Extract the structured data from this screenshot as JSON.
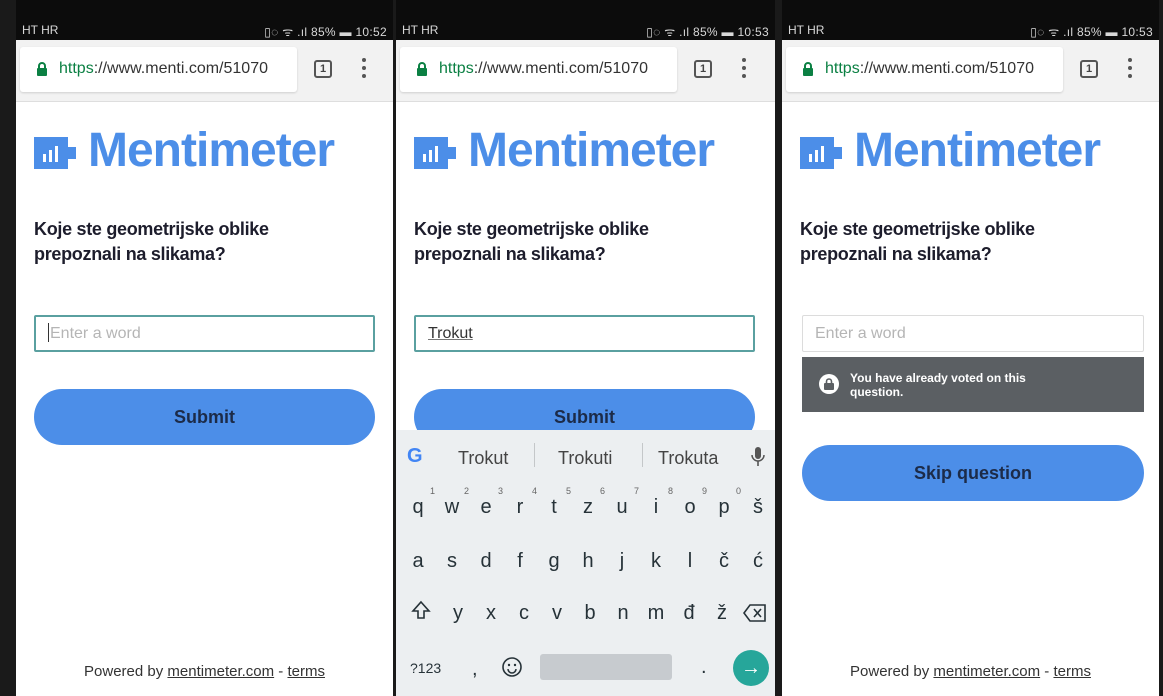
{
  "colors": {
    "brand": "#4c8ee8",
    "status_bar": "#0c0c0c",
    "banner": "#5b5f63",
    "enter_key": "#26a69a"
  },
  "screens": [
    {
      "carrier": "HT HR",
      "status_icons": "▯◌ ᯤ .ıl 85% ▬ 10:52",
      "url_scheme": "https",
      "url_rest": "://www.menti.com/51070",
      "tab_count": "1",
      "brand": "Mentimeter",
      "question": "Koje ste geometrijske oblike prepoznali na slikama?",
      "input_placeholder": "Enter a word",
      "button": "Submit",
      "footer_prefix": "Powered by ",
      "footer_link": "mentimeter.com",
      "footer_sep": " - ",
      "footer_terms": "terms"
    },
    {
      "carrier": "HT HR",
      "status_icons": "▯◌ ᯤ .ıl 85% ▬ 10:53",
      "url_scheme": "https",
      "url_rest": "://www.menti.com/51070",
      "tab_count": "1",
      "brand": "Mentimeter",
      "question": "Koje ste geometrijske oblike prepoznali na slikama?",
      "input_value": "Trokut",
      "button": "Submit"
    },
    {
      "carrier": "HT HR",
      "status_icons": "▯◌ ᯤ .ıl 85% ▬ 10:53",
      "url_scheme": "https",
      "url_rest": "://www.menti.com/51070",
      "tab_count": "1",
      "brand": "Mentimeter",
      "question": "Koje ste geometrijske oblike prepoznali na slikama?",
      "input_placeholder": "Enter a word",
      "voted_message": "You have already voted on this question.",
      "button": "Skip question",
      "footer_prefix": "Powered by ",
      "footer_link": "mentimeter.com",
      "footer_sep": " - ",
      "footer_terms": "terms"
    }
  ],
  "keyboard": {
    "suggestions": [
      "Trokut",
      "Trokuti",
      "Trokuta"
    ],
    "row1": [
      "q",
      "w",
      "e",
      "r",
      "t",
      "z",
      "u",
      "i",
      "o",
      "p",
      "š"
    ],
    "row1_hints": [
      "1",
      "2",
      "3",
      "4",
      "5",
      "6",
      "7",
      "8",
      "9",
      "0",
      ""
    ],
    "row2": [
      "a",
      "s",
      "d",
      "f",
      "g",
      "h",
      "j",
      "k",
      "l",
      "č",
      "ć"
    ],
    "row3": [
      "y",
      "x",
      "c",
      "v",
      "b",
      "n",
      "m",
      "đ",
      "ž"
    ],
    "symbols_key": "?123",
    "comma_key": ",",
    "period_key": "."
  }
}
